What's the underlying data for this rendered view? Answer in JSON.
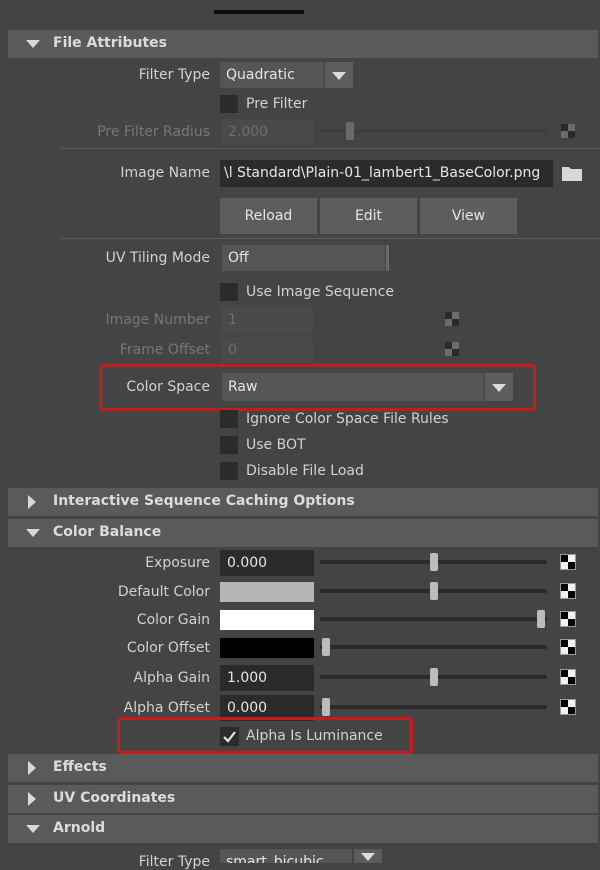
{
  "sections": {
    "file_attributes": "File Attributes",
    "interactive_sequence": "Interactive Sequence Caching Options",
    "color_balance": "Color Balance",
    "effects": "Effects",
    "uv_coordinates": "UV Coordinates",
    "arnold": "Arnold"
  },
  "file_attributes": {
    "filter_type_label": "Filter Type",
    "filter_type_value": "Quadratic",
    "pre_filter_label": "Pre Filter",
    "pre_filter_checked": false,
    "pre_filter_radius_label": "Pre Filter Radius",
    "pre_filter_radius_value": "2.000",
    "image_name_label": "Image Name",
    "image_name_value": "\\l Standard\\Plain-01_lambert1_BaseColor.png",
    "reload_label": "Reload",
    "edit_label": "Edit",
    "view_label": "View",
    "uv_tiling_label": "UV Tiling Mode",
    "uv_tiling_value": "Off",
    "use_image_sequence_label": "Use Image Sequence",
    "image_number_label": "Image Number",
    "image_number_value": "1",
    "frame_offset_label": "Frame Offset",
    "frame_offset_value": "0",
    "color_space_label": "Color Space",
    "color_space_value": "Raw",
    "ignore_color_space_label": "Ignore Color Space File Rules",
    "use_bot_label": "Use BOT",
    "disable_file_load_label": "Disable File Load"
  },
  "color_balance": {
    "exposure_label": "Exposure",
    "exposure_value": "0.000",
    "exposure_slider": 0.5,
    "default_color_label": "Default Color",
    "default_color_hex": "#b5b5b5",
    "default_color_slider": 0.5,
    "color_gain_label": "Color Gain",
    "color_gain_hex": "#ffffff",
    "color_gain_slider": 1.0,
    "color_offset_label": "Color Offset",
    "color_offset_hex": "#000000",
    "color_offset_slider": 0.0,
    "alpha_gain_label": "Alpha Gain",
    "alpha_gain_value": "1.000",
    "alpha_gain_slider": 0.5,
    "alpha_offset_label": "Alpha Offset",
    "alpha_offset_value": "0.000",
    "alpha_offset_slider": 0.0,
    "alpha_is_luminance_label": "Alpha Is Luminance",
    "alpha_is_luminance_checked": true
  },
  "arnold": {
    "filter_type_label": "Filter Type",
    "filter_type_value": "smart_bicubic"
  },
  "colors": {
    "panel_bg": "#444444",
    "header_bg": "#5a5a5a",
    "field_bg": "#2b2b2b",
    "highlight": "#c61b1b"
  }
}
